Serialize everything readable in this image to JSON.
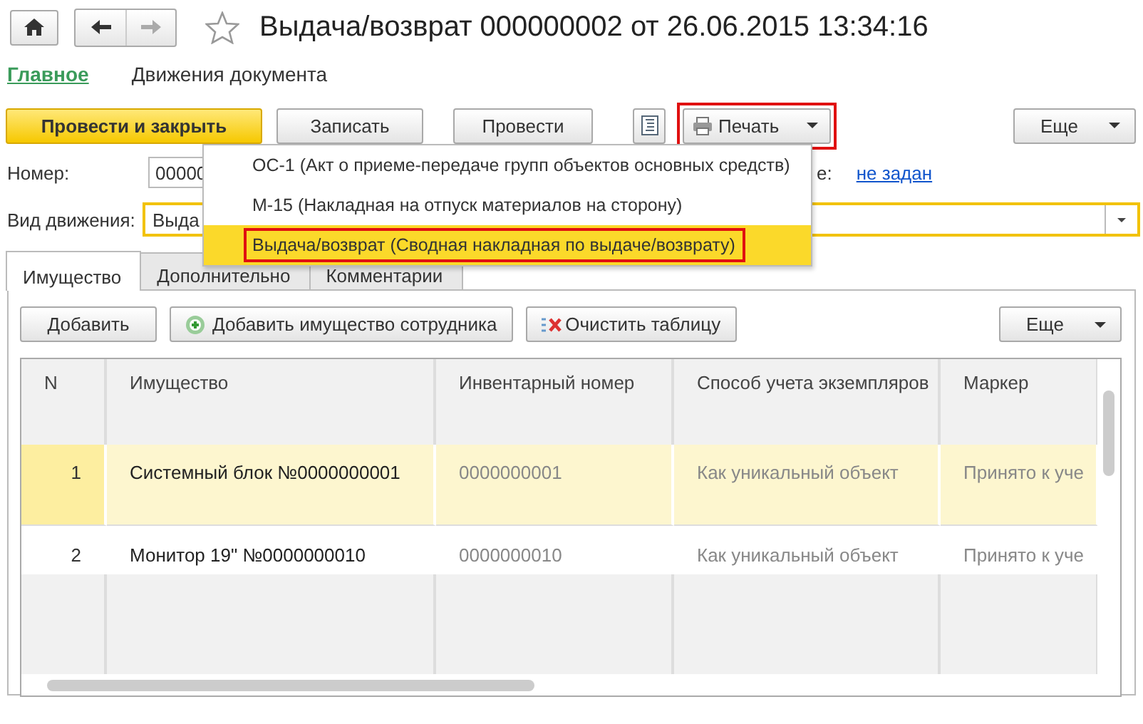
{
  "window": {
    "title": "Выдача/возврат 000000002 от 26.06.2015 13:34:16"
  },
  "sections": [
    {
      "label": "Главное",
      "selected": true
    },
    {
      "label": "Движения документа",
      "selected": false
    }
  ],
  "toolbar": [
    {
      "kind": "primary",
      "label": "Провести и закрыть",
      "outlined": false
    },
    {
      "kind": "plain",
      "label": "Записать",
      "outlined": false
    },
    {
      "kind": "plain",
      "label": "Провести",
      "outlined": false
    },
    {
      "kind": "structure",
      "outlined": false
    },
    {
      "kind": "print",
      "label": "Печать",
      "outlined": true
    },
    {
      "kind": "more",
      "label": "Еще",
      "outlined": false
    }
  ],
  "form": {
    "number_label": "Номер:",
    "number_value": "00000",
    "label_tail": "е:",
    "link": "не задан",
    "movement_label": "Вид движения:",
    "movement_value": "Выда"
  },
  "print_menu": [
    {
      "label": "ОС-1 (Акт о приеме-передаче групп объектов основных средств)",
      "selected": false,
      "outlined": false
    },
    {
      "label": "М-15 (Накладная на отпуск материалов на сторону)",
      "selected": false,
      "outlined": false
    },
    {
      "label": "Выдача/возврат (Сводная накладная по выдаче/возврату)",
      "selected": true,
      "outlined": true
    }
  ],
  "tabs": [
    {
      "label": "Имущество",
      "selected": true
    },
    {
      "label": "Дополнительно",
      "selected": false
    },
    {
      "label": "Комментарии",
      "selected": false
    }
  ],
  "table_toolbar": [
    {
      "kind": "plain",
      "label": "Добавить"
    },
    {
      "kind": "add-employee",
      "label": "Добавить имущество сотрудника"
    },
    {
      "kind": "clear",
      "label": "Очистить таблицу"
    },
    {
      "kind": "more",
      "label": "Еще"
    }
  ],
  "table": {
    "columns": [
      "N",
      "Имущество",
      "Инвентарный номер",
      "Способ учета экземпляров",
      "Маркер"
    ],
    "rows": [
      {
        "n": "1",
        "item": "Системный блок №0000000001",
        "inventory": "0000000001",
        "method": "Как уникальный объект",
        "marker": "Принято к уче",
        "selected": true
      },
      {
        "n": "2",
        "item": "Монитор 19\" №0000000010",
        "inventory": "0000000010",
        "method": "Как уникальный объект",
        "marker": "Принято к уче",
        "selected": false
      }
    ]
  }
}
